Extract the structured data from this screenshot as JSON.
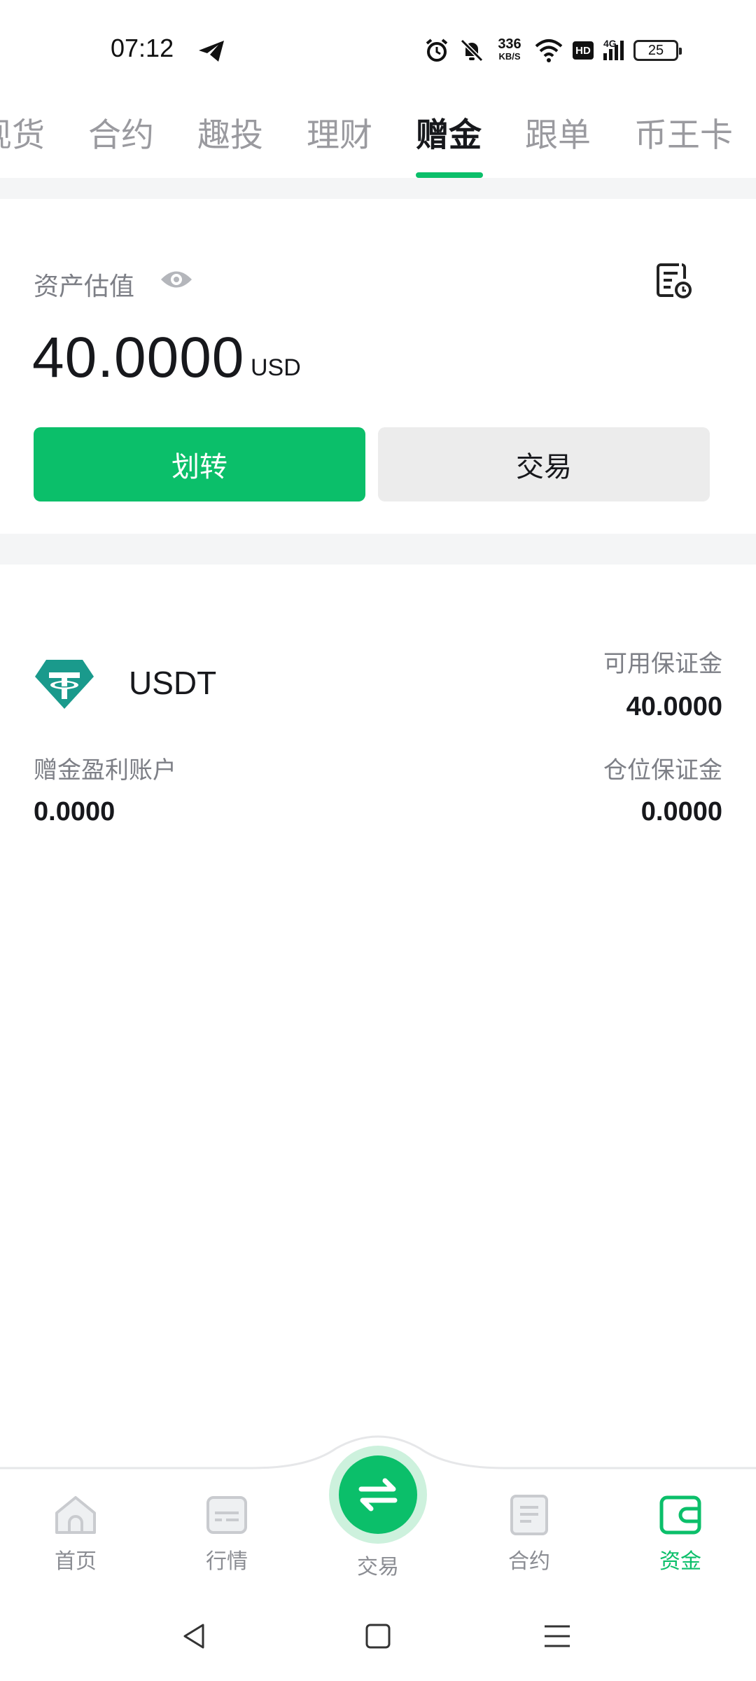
{
  "status_bar": {
    "time": "07:12",
    "network_speed_value": "336",
    "network_speed_unit": "KB/S",
    "hd_label": "HD",
    "signal_label": "4G",
    "battery": "25"
  },
  "tabs": [
    {
      "label": "现货"
    },
    {
      "label": "合约"
    },
    {
      "label": "趣投"
    },
    {
      "label": "理财"
    },
    {
      "label": "赠金"
    },
    {
      "label": "跟单"
    },
    {
      "label": "币王卡"
    }
  ],
  "active_tab": "赠金",
  "asset": {
    "label": "资产估值",
    "value": "40.0000",
    "unit": "USD",
    "transfer_button": "划转",
    "trade_button": "交易"
  },
  "coin": {
    "name": "USDT",
    "available_margin_label": "可用保证金",
    "available_margin_value": "40.0000",
    "profit_account_label": "赠金盈利账户",
    "profit_account_value": "0.0000",
    "position_margin_label": "仓位保证金",
    "position_margin_value": "0.0000"
  },
  "bottom_nav": {
    "home": "首页",
    "market": "行情",
    "trade": "交易",
    "futures": "合约",
    "assets": "资金"
  },
  "colors": {
    "accent": "#0bbf6a",
    "tether": "#1a9a8c"
  }
}
